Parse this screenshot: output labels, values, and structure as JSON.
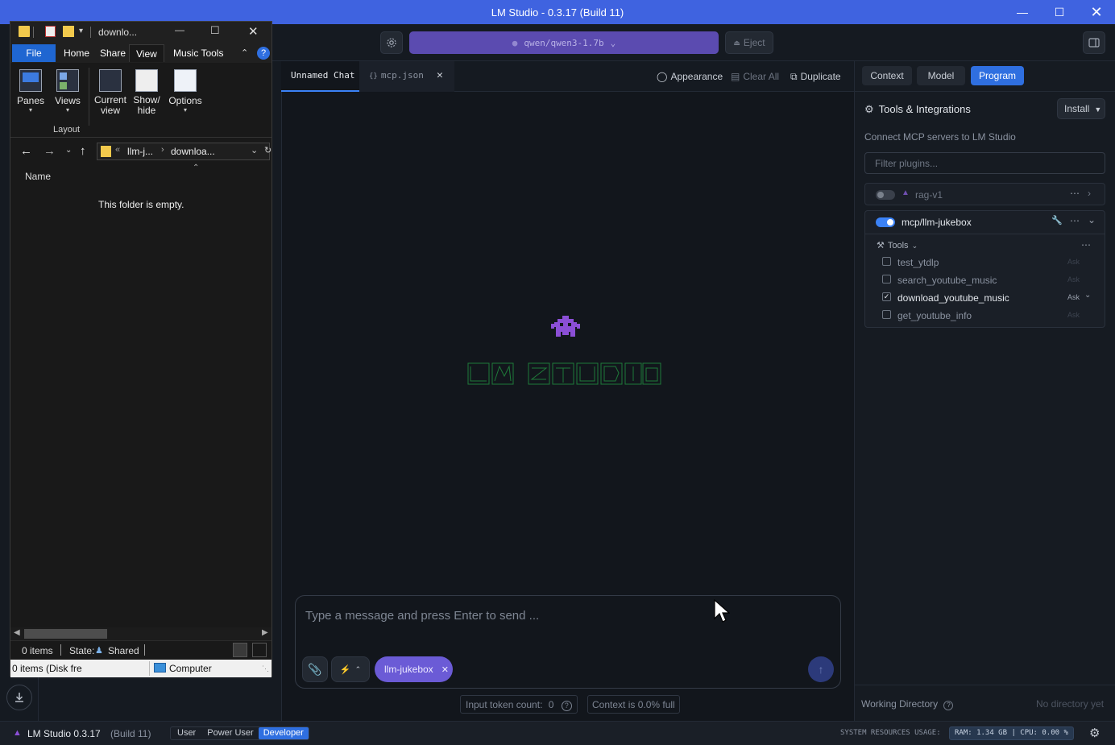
{
  "window": {
    "title": "LM Studio - 0.3.17 (Build 11)"
  },
  "topbar": {
    "model_name": "qwen/qwen3-1.7b",
    "eject_label": "Eject"
  },
  "tabs": [
    {
      "label": "Unnamed Chat"
    },
    {
      "label": "mcp.json",
      "prefix": "{}"
    }
  ],
  "chat_actions": {
    "appearance": "Appearance",
    "clear_all": "Clear All",
    "duplicate": "Duplicate"
  },
  "composer": {
    "placeholder": "Type a message and press Enter to send ...",
    "plugin_chip": "llm-jukebox",
    "token_count_label": "Input token count:",
    "token_count_value": "0",
    "context_label": "Context is 0.0% full"
  },
  "right_panel": {
    "tabs": [
      "Context",
      "Model",
      "Program"
    ],
    "active_tab": "Program",
    "section_title": "Tools & Integrations",
    "install_label": "Install",
    "subtitle": "Connect MCP servers to LM Studio",
    "filter_placeholder": "Filter plugins...",
    "plugins": [
      {
        "name": "rag-v1",
        "enabled": false
      },
      {
        "name": "mcp/llm-jukebox",
        "enabled": true
      }
    ],
    "tools_label": "Tools",
    "tools": [
      {
        "name": "test_ytdlp",
        "checked": false,
        "mode": "Ask"
      },
      {
        "name": "search_youtube_music",
        "checked": false,
        "mode": "Ask"
      },
      {
        "name": "download_youtube_music",
        "checked": true,
        "mode": "Ask"
      },
      {
        "name": "get_youtube_info",
        "checked": false,
        "mode": "Ask"
      }
    ],
    "working_dir_label": "Working Directory",
    "working_dir_value": "No directory yet"
  },
  "statusbar": {
    "app_version": "LM Studio 0.3.17",
    "build": "(Build 11)",
    "modes": [
      "User",
      "Power User",
      "Developer"
    ],
    "active_mode": "Developer",
    "resources_label": "SYSTEM RESOURCES USAGE:",
    "ram": "RAM: 1.34 GB",
    "cpu": "CPU: 0.00 %"
  },
  "explorer": {
    "title": "downlo...",
    "ribbon_tabs": [
      "File",
      "Home",
      "Share",
      "View",
      "Music Tools"
    ],
    "active_ribbon_tab": "View",
    "ribbon_buttons": [
      {
        "label": "Panes"
      },
      {
        "label": "Views"
      },
      {
        "label": "Current view"
      },
      {
        "label": "Show/ hide"
      },
      {
        "label": "Options"
      }
    ],
    "group_label": "Layout",
    "breadcrumb": [
      "llm-j...",
      "downloa..."
    ],
    "column_name": "Name",
    "empty_text": "This folder is empty.",
    "status_items": "0 items",
    "status_state_label": "State:",
    "status_state_value": "Shared",
    "details_items": "0 items (Disk fre",
    "details_location": "Computer"
  },
  "colors": {
    "accent": "#3b82f6",
    "titlebar": "#3f63e0",
    "model_pill": "#5b4bb0",
    "chip": "#6b5bd6"
  }
}
